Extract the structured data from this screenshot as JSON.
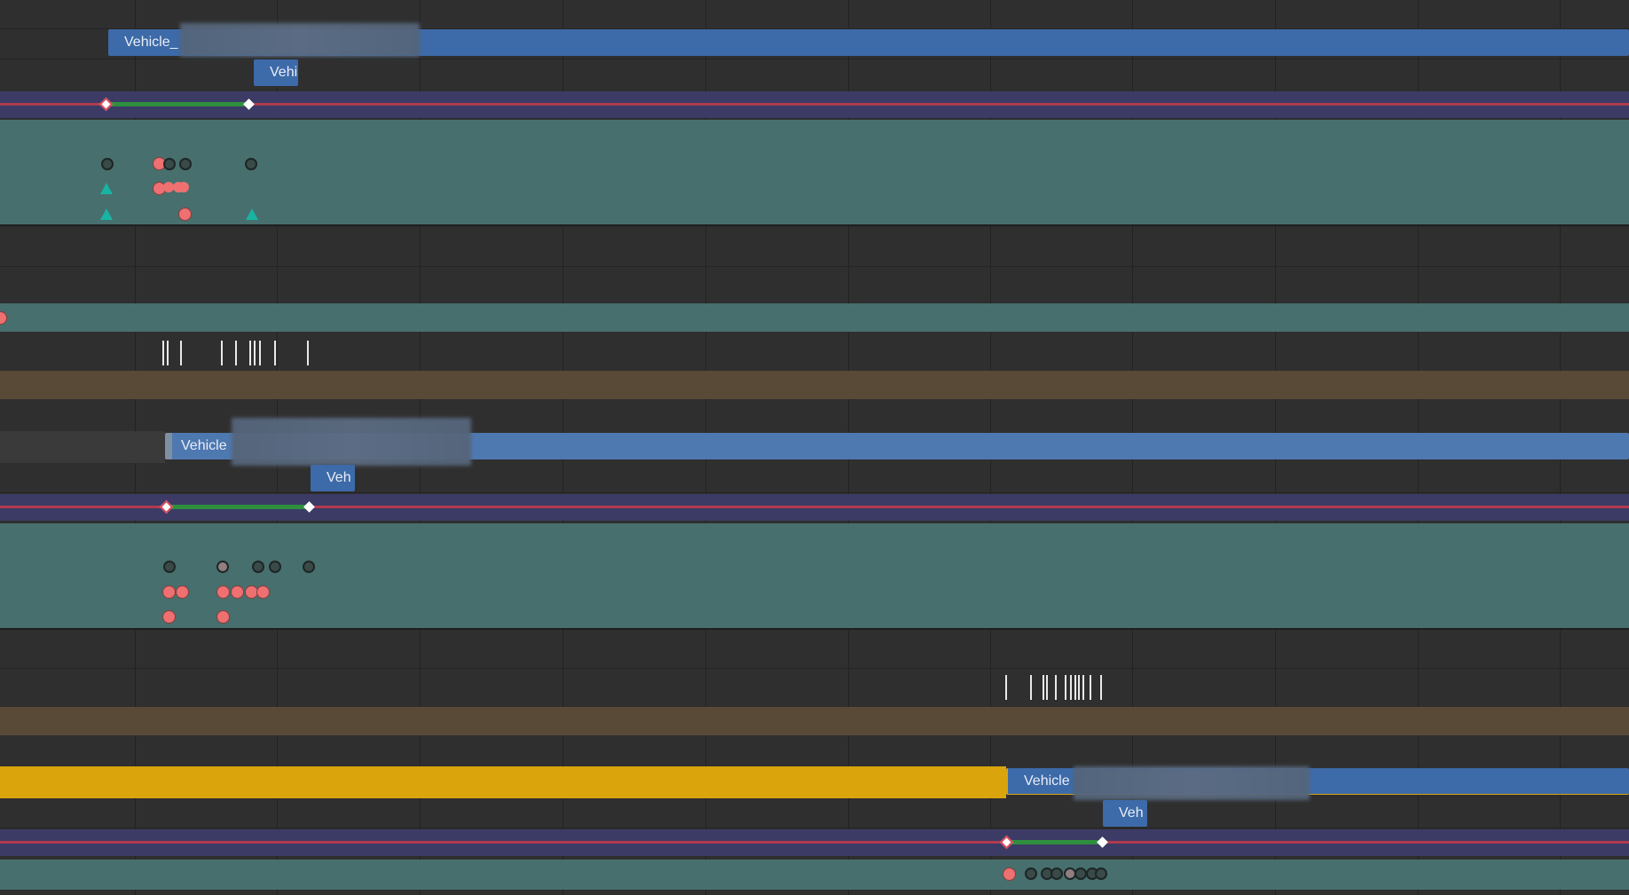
{
  "track1": {
    "clip_main_label": "Vehicle_",
    "clip_sub_label": "Vehi"
  },
  "track2": {
    "clip_main_label": "Vehicle",
    "clip_sub_label": "Veh"
  },
  "track3": {
    "clip_main_label": "Vehicle",
    "clip_sub_label": "Veh"
  },
  "colors": {
    "background": "#2f2f2f",
    "clip_blue": "#3d6aa8",
    "curve_band": "#3b3b66",
    "curve_red": "#b03a4e",
    "curve_green": "#2f8f3f",
    "event_teal": "#476f6d",
    "marker_brown": "#594a38",
    "selected_gold": "#d9a40c",
    "dot_red": "#ee7070",
    "triangle_teal": "#19b3a2"
  },
  "icons": [
    "keyframe-diamond-icon",
    "event-dot-icon",
    "event-triangle-icon",
    "marker-tick-icon"
  ]
}
